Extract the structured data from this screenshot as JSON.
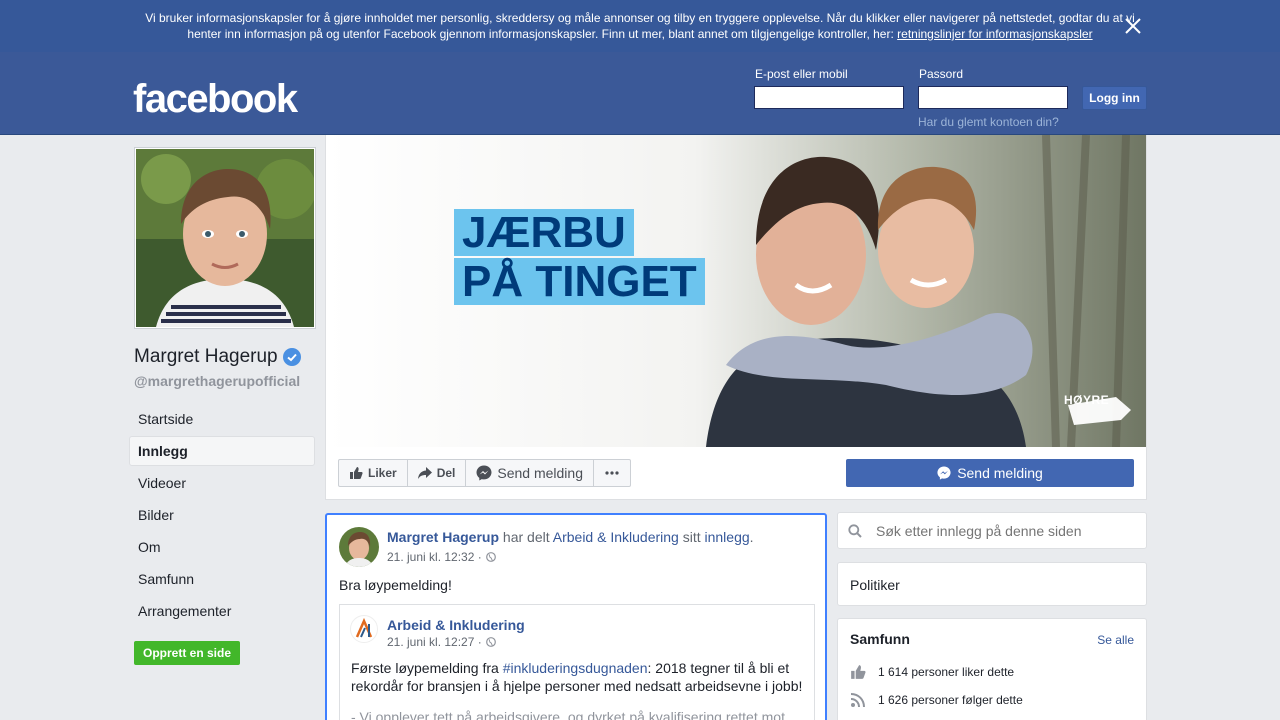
{
  "cookie": {
    "text": "Vi bruker informasjonskapsler for å gjøre innholdet mer personlig, skreddersy og måle annonser og tilby en tryggere opplevelse. Når du klikker eller navigerer på nettstedet, godtar du at vi henter inn informasjon på og utenfor Facebook gjennom informasjonskapsler. Finn ut mer, blant annet om tilgjengelige kontroller, her: ",
    "link": "retningslinjer for informasjonskapsler"
  },
  "header": {
    "logo": "facebook",
    "email_label": "E-post eller mobil",
    "password_label": "Passord",
    "login_button": "Logg inn",
    "forgot": "Har du glemt kontoen din?"
  },
  "profile": {
    "name": "Margret Hagerup",
    "handle": "@margrethagerupofficial"
  },
  "nav": {
    "items": [
      {
        "label": "Startside"
      },
      {
        "label": "Innlegg"
      },
      {
        "label": "Videoer"
      },
      {
        "label": "Bilder"
      },
      {
        "label": "Om"
      },
      {
        "label": "Samfunn"
      },
      {
        "label": "Arrangementer"
      }
    ],
    "create_page": "Opprett en side"
  },
  "cover": {
    "line1": "JÆRBU",
    "line2": "PÅ TINGET",
    "brand": "HØYRE"
  },
  "actions": {
    "like": "Liker",
    "share": "Del",
    "message": "Send melding",
    "send_message_primary": "Send melding"
  },
  "post": {
    "author": "Margret Hagerup",
    "shared_text": "har delt",
    "shared_page": "Arbeid & Inkludering",
    "its": "sitt",
    "post_word": "innlegg",
    "period": ".",
    "time": "21. juni kl. 12:32 ·",
    "text": "Bra løypemelding!",
    "shared": {
      "name": "Arbeid & Inkludering",
      "time": "21. juni kl. 12:27 ·",
      "text_before": "Første løypemelding fra ",
      "hashtag": "#inkluderingsdugnaden",
      "text_after": ": 2018 tegner til å bli et rekordår for bransjen i å hjelpe personer med nedsatt arbeidsevne i jobb!",
      "more": "- Vi opplever tett på arbeidsgivere, og dyrket på kvalifisering rettet mot"
    }
  },
  "sidebar": {
    "search_placeholder": "Søk etter innlegg på denne siden",
    "category": "Politiker",
    "community_title": "Samfunn",
    "see_all": "Se alle",
    "likes": "1 614 personer liker dette",
    "follows": "1 626 personer følger dette"
  },
  "colors": {
    "brand_blue": "#3b5998",
    "button_blue": "#4267b2",
    "green": "#42b72a",
    "link": "#365899"
  }
}
